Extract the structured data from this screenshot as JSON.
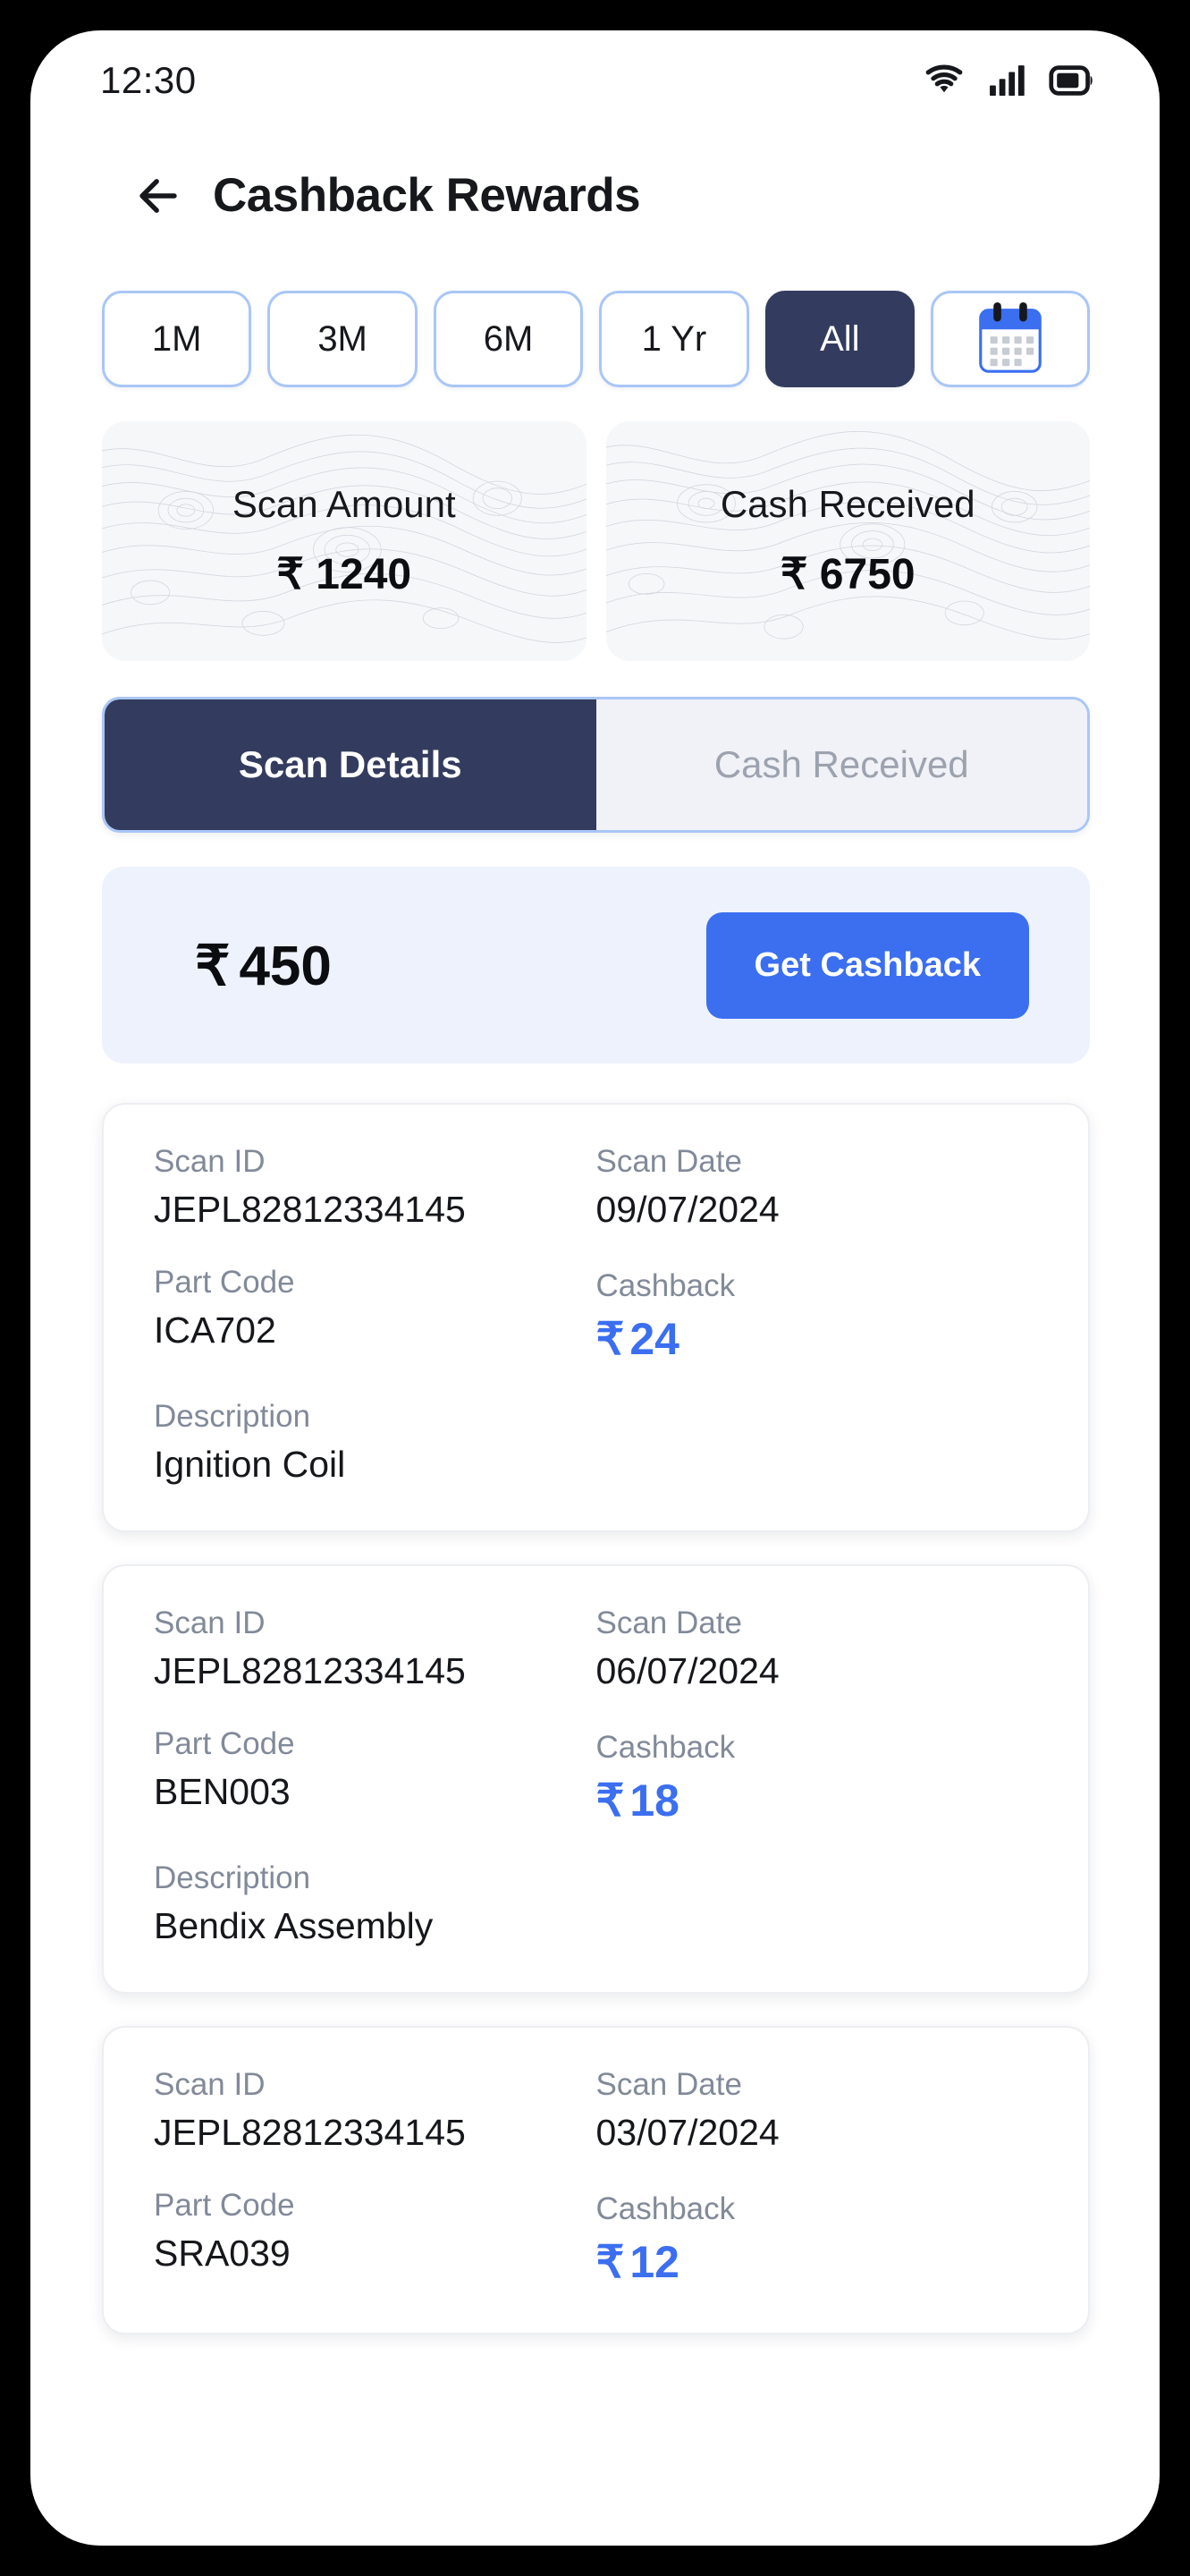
{
  "status_bar": {
    "time": "12:30",
    "icons": [
      "wifi-icon",
      "signal-icon",
      "battery-icon"
    ]
  },
  "app_bar": {
    "back_icon": "back-arrow-icon",
    "title": "Cashback Rewards"
  },
  "filters": {
    "chips": [
      {
        "label": "1M",
        "selected": false
      },
      {
        "label": "3M",
        "selected": false
      },
      {
        "label": "6M",
        "selected": false
      },
      {
        "label": "1 Yr",
        "selected": false
      },
      {
        "label": "All",
        "selected": true
      }
    ],
    "calendar_icon": "calendar-icon"
  },
  "summary": {
    "cards": [
      {
        "label": "Scan Amount",
        "value": "₹ 1240"
      },
      {
        "label": "Cash Received",
        "value": "₹  6750"
      }
    ]
  },
  "tabs": [
    {
      "label": "Scan Details",
      "active": true
    },
    {
      "label": "Cash Received",
      "active": false
    }
  ],
  "cashback_banner": {
    "rupee": "₹",
    "amount": "450",
    "button_label": "Get Cashback"
  },
  "scan_labels": {
    "scan_id": "Scan ID",
    "scan_date": "Scan Date",
    "part_code": "Part Code",
    "cashback": "Cashback",
    "description": "Description",
    "rupee": "₹"
  },
  "scans": [
    {
      "scan_id": "JEPL82812334145",
      "scan_date": "09/07/2024",
      "part_code": "ICA702",
      "cashback": "24",
      "description": "Ignition Coil"
    },
    {
      "scan_id": "JEPL82812334145",
      "scan_date": "06/07/2024",
      "part_code": "BEN003",
      "cashback": "18",
      "description": "Bendix Assembly"
    },
    {
      "scan_id": "JEPL82812334145",
      "scan_date": "03/07/2024",
      "part_code": "SRA039",
      "cashback": "12",
      "description": ""
    }
  ],
  "colors": {
    "navy": "#333c5e",
    "blue": "#3b6ff0",
    "chip_border": "#a9c6f7",
    "banner_bg": "#eef2fd",
    "label_gray": "#828a99"
  }
}
